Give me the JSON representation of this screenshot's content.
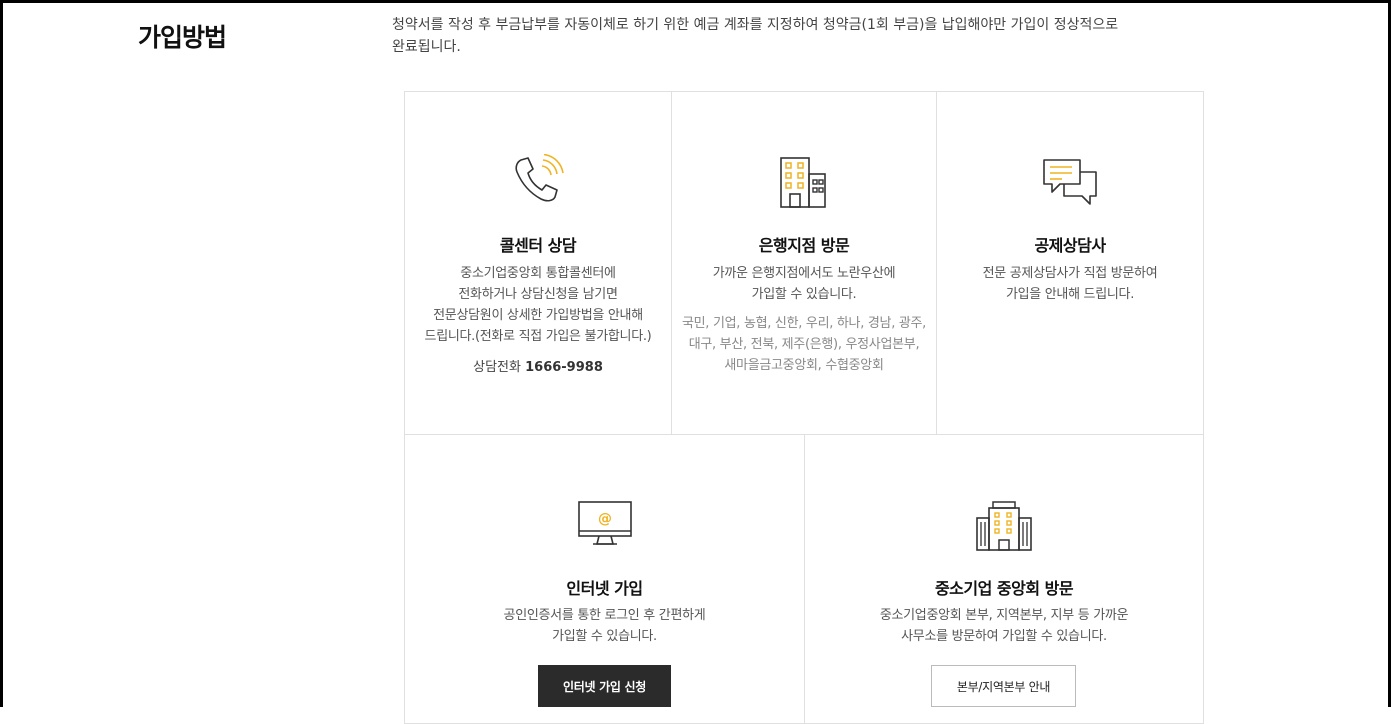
{
  "section": {
    "title": "가입방법",
    "intro_line1": "청약서를 작성 후 부금납부를 자동이체로 하기 위한 예금 계좌를 지정하여 청약금(1회 부금)을 납입해야만 가입이 정상적으로",
    "intro_line2": "완료됩니다."
  },
  "accent_color": "#f0b323",
  "cards": {
    "callcenter": {
      "icon": "phone-icon",
      "title": "콜센터 상담",
      "desc": [
        "중소기업중앙회 통합콜센터에",
        "전화하거나 상담신청을 남기면",
        "전문상담원이 상세한 가입방법을 안내해",
        "드립니다.(전화로 직접 가입은 불가합니다.)"
      ],
      "phone_label": "상담전화",
      "phone_number": "1666-9988"
    },
    "bank": {
      "icon": "bank-building-icon",
      "title": "은행지점 방문",
      "desc": [
        "가까운 은행지점에서도 노란우산에",
        "가입할 수 있습니다."
      ],
      "banks": [
        "국민, 기업, 농협, 신한, 우리, 하나, 경남, 광주,",
        "대구, 부산, 전북, 제주(은행), 우정사업본부,",
        "새마을금고중앙회, 수협중앙회"
      ]
    },
    "agent": {
      "icon": "chat-bubbles-icon",
      "title": "공제상담사",
      "desc": [
        "전문 공제상담사가 직접 방문하여",
        "가입을 안내해 드립니다."
      ]
    },
    "internet": {
      "icon": "monitor-at-icon",
      "title": "인터넷 가입",
      "desc": [
        "공인인증서를 통한 로그인 후 간편하게",
        "가입할 수 있습니다."
      ],
      "button": "인터넷 가입 신청"
    },
    "hq": {
      "icon": "office-tower-icon",
      "title": "중소기업 중앙회 방문",
      "desc": [
        "중소기업중앙회 본부, 지역본부, 지부 등 가까운",
        "사무소를 방문하여 가입할 수 있습니다."
      ],
      "button": "본부/지역본부 안내"
    }
  }
}
